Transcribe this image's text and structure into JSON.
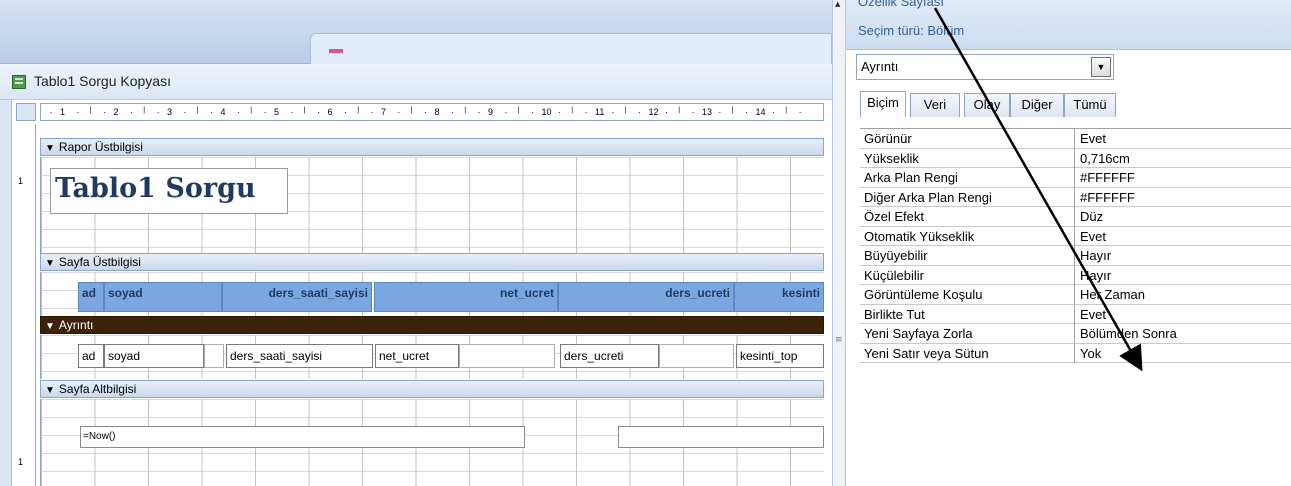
{
  "window": {
    "title": "Tablo1 Sorgu Kopyası"
  },
  "ruler": {
    "marks": [
      "1",
      "2",
      "3",
      "4",
      "5",
      "6",
      "7",
      "8",
      "9",
      "10",
      "11",
      "12",
      "13",
      "14"
    ]
  },
  "vruler": {
    "marks": [
      "1",
      "1"
    ]
  },
  "sections": {
    "report_header": "Rapor Üstbilgisi",
    "page_header": "Sayfa Üstbilgisi",
    "detail": "Ayrıntı",
    "page_footer": "Sayfa Altbilgisi"
  },
  "report_title": "Tablo1 Sorgu",
  "column_headers": [
    "ad",
    "soyad",
    "ders_saati_sayisi",
    "net_ucret",
    "ders_ucreti",
    "kesinti"
  ],
  "detail_fields": [
    "ad",
    "soyad",
    "ders_saati_sayisi",
    "net_ucret",
    "ders_ucreti",
    "kesinti_top"
  ],
  "footer_fields": {
    "now": "=Now()"
  },
  "property_sheet": {
    "title": "Özellik Sayfası",
    "selection_type": "Seçim türü:  Bölüm",
    "selected_object": "Ayrıntı",
    "tabs": [
      "Biçim",
      "Veri",
      "Olay",
      "Diğer",
      "Tümü"
    ],
    "active_tab": "Biçim",
    "properties": [
      {
        "name": "Görünür",
        "value": "Evet"
      },
      {
        "name": "Yükseklik",
        "value": "0,716cm"
      },
      {
        "name": "Arka Plan Rengi",
        "value": "#FFFFFF"
      },
      {
        "name": "Diğer Arka Plan Rengi",
        "value": "#FFFFFF"
      },
      {
        "name": "Özel Efekt",
        "value": "Düz"
      },
      {
        "name": "Otomatik Yükseklik",
        "value": "Evet"
      },
      {
        "name": "Büyüyebilir",
        "value": "Hayır"
      },
      {
        "name": "Küçülebilir",
        "value": "Hayır"
      },
      {
        "name": "Görüntüleme Koşulu",
        "value": "Her Zaman"
      },
      {
        "name": "Birlikte Tut",
        "value": "Evet"
      },
      {
        "name": "Yeni Sayfaya Zorla",
        "value": "Bölümden Sonra"
      },
      {
        "name": "Yeni Satır veya Sütun",
        "value": "Yok"
      }
    ]
  },
  "colors": {
    "detail_bar": "#3c2308",
    "header_label_bg": "#7ba7e0",
    "title_text": "#1f3a5f"
  },
  "icons": {
    "section_arrow": "arrow-down-icon",
    "combo": "chevron-down-icon",
    "form": "report-icon"
  }
}
